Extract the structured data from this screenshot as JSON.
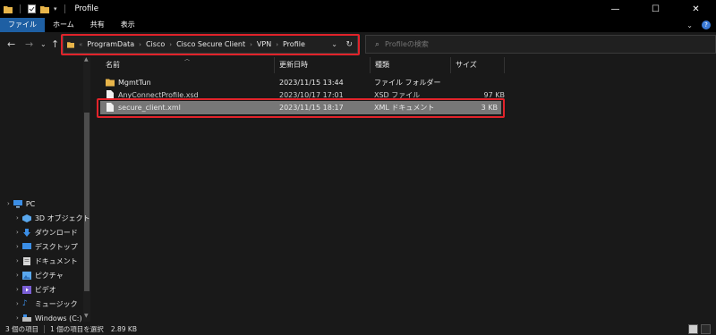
{
  "window": {
    "title": "Profile",
    "minimize": "—",
    "maximize": "☐",
    "close": "✕"
  },
  "ribbon": {
    "tabs": [
      "ファイル",
      "ホーム",
      "共有",
      "表示"
    ],
    "expand_icon": "chevron-down-icon",
    "help_icon": "help-icon"
  },
  "address": {
    "crumbs": [
      "ProgramData",
      "Cisco",
      "Cisco Secure Client",
      "VPN",
      "Profile"
    ],
    "recent_icon": "chevron-down-icon",
    "refresh_icon": "refresh-icon"
  },
  "search": {
    "placeholder": "Profileの検索"
  },
  "columns": {
    "name": "名前",
    "date": "更新日時",
    "type": "種類",
    "size": "サイズ"
  },
  "files": [
    {
      "name": "MgmtTun",
      "date": "2023/11/15 13:44",
      "type": "ファイル フォルダー",
      "size": "",
      "icon": "folder-icon",
      "selected": false
    },
    {
      "name": "AnyConnectProfile.xsd",
      "date": "2023/10/17 17:01",
      "type": "XSD ファイル",
      "size": "97 KB",
      "icon": "file-icon",
      "selected": false
    },
    {
      "name": "secure_client.xml",
      "date": "2023/11/15 18:17",
      "type": "XML ドキュメント",
      "size": "3 KB",
      "icon": "file-icon",
      "selected": true
    }
  ],
  "nav": {
    "items": [
      {
        "label": "PC",
        "icon": "pc-icon"
      },
      {
        "label": "3D オブジェクト",
        "icon": "3d-objects-icon"
      },
      {
        "label": "ダウンロード",
        "icon": "download-icon"
      },
      {
        "label": "デスクトップ",
        "icon": "desktop-icon"
      },
      {
        "label": "ドキュメント",
        "icon": "documents-icon"
      },
      {
        "label": "ピクチャ",
        "icon": "pictures-icon"
      },
      {
        "label": "ビデオ",
        "icon": "videos-icon"
      },
      {
        "label": "ミュージック",
        "icon": "music-icon"
      },
      {
        "label": "Windows (C:)",
        "icon": "drive-icon"
      }
    ]
  },
  "status": {
    "count": "3 個の項目",
    "selected": "1 個の項目を選択",
    "size": "2.89 KB"
  },
  "colors": {
    "highlight": "#e1232a",
    "folder": "#e8b54a",
    "selection": "#777777",
    "file_tab": "#1e5fa3"
  }
}
